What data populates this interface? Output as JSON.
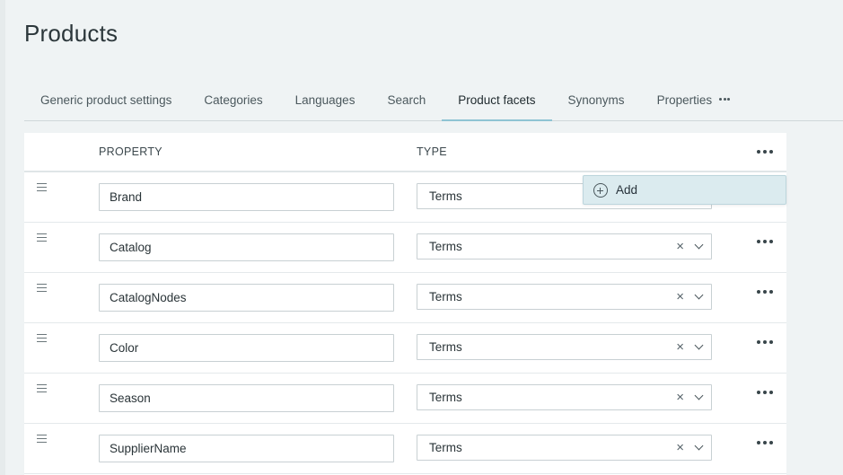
{
  "page": {
    "title": "Products"
  },
  "tabs": [
    {
      "label": "Generic product settings"
    },
    {
      "label": "Categories"
    },
    {
      "label": "Languages"
    },
    {
      "label": "Search"
    },
    {
      "label": "Product facets",
      "active": true
    },
    {
      "label": "Synonyms"
    },
    {
      "label": "Properties",
      "more_icon": "ellipsis-icon"
    }
  ],
  "table": {
    "headers": {
      "property": "PROPERTY",
      "type": "TYPE"
    },
    "header_menu_icon": "more-horizontal-icon",
    "rows": [
      {
        "property": "Brand",
        "type": "Terms"
      },
      {
        "property": "Catalog",
        "type": "Terms"
      },
      {
        "property": "CatalogNodes",
        "type": "Terms"
      },
      {
        "property": "Color",
        "type": "Terms"
      },
      {
        "property": "Season",
        "type": "Terms"
      },
      {
        "property": "SupplierName",
        "type": "Terms"
      }
    ]
  },
  "context_menu": {
    "items": [
      {
        "label": "Add",
        "icon": "plus-circle-icon"
      }
    ]
  },
  "icons": {
    "clear": "×",
    "drag": "drag-handle-icon",
    "dropdown": "chevron-down-icon"
  },
  "colors": {
    "background": "#eff3f4",
    "active_tab_underline": "#8fc4d3",
    "menu_highlight": "#dbebef"
  }
}
